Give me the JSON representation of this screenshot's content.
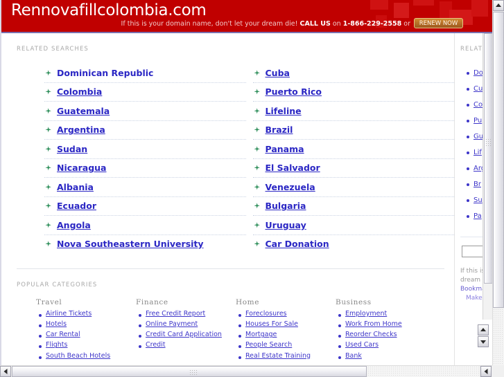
{
  "banner": {
    "domain": "Rennovafillcolombia.com",
    "tagline_pre": "If this is your domain name, don't let your dream die!",
    "tagline_callus": "CALL US",
    "tagline_on": "on",
    "tagline_phone": "1-866-229-2558",
    "tagline_or": "or",
    "renew_label": "RENEW NOW",
    "bg_color": "#c00000",
    "renew_color": "#b8722a"
  },
  "related": {
    "label": "RELATED SEARCHES",
    "left": [
      "Dominican Republic",
      "Colombia",
      "Guatemala",
      "Argentina",
      "Sudan",
      "Nicaragua",
      "Albania",
      "Ecuador",
      "Angola",
      "Nova Southeastern University"
    ],
    "right": [
      "Cuba",
      "Puerto Rico",
      "Lifeline",
      "Brazil",
      "Panama",
      "El Salvador",
      "Venezuela",
      "Bulgaria",
      "Uruguay",
      "Car Donation"
    ],
    "link_color": "#2b27c4",
    "bullet_icon": "green-star-icon"
  },
  "popular": {
    "label": "POPULAR CATEGORIES",
    "columns": [
      {
        "title": "Travel",
        "items": [
          "Airline Tickets",
          "Hotels",
          "Car Rental",
          "Flights",
          "South Beach Hotels"
        ]
      },
      {
        "title": "Finance",
        "items": [
          "Free Credit Report",
          "Online Payment",
          "Credit Card Application",
          "Credit"
        ]
      },
      {
        "title": "Home",
        "items": [
          "Foreclosures",
          "Houses For Sale",
          "Mortgage",
          "People Search",
          "Real Estate Training"
        ]
      },
      {
        "title": "Business",
        "items": [
          "Employment",
          "Work From Home",
          "Reorder Checks",
          "Used Cars",
          "Bank"
        ]
      }
    ]
  },
  "sidebar": {
    "label": "RELATED",
    "items": [
      "Do",
      "Cu",
      "Co",
      "Pu",
      "Gu",
      "Lif",
      "Arg",
      "Br",
      "Su",
      "Pa"
    ],
    "input_value": "",
    "promo_line1": "If this is yo",
    "promo_line2": "dream die",
    "promo_link1": "Bookmark",
    "promo_link2": "Make thi"
  },
  "scrollbars": {
    "v_up_icon": "scroll-up-arrow-icon",
    "v_down_icon": "scroll-down-arrow-icon",
    "h_left_icon": "scroll-left-arrow-icon",
    "h_right_icon": "scroll-right-arrow-icon"
  }
}
